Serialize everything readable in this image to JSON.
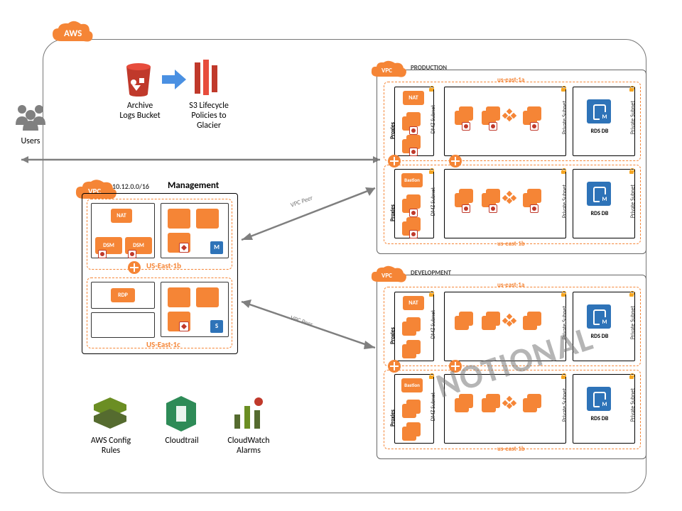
{
  "aws_badge": "AWS",
  "users_label": "Users",
  "archive": {
    "label": "Archive\nLogs Bucket"
  },
  "lifecycle": {
    "label": "S3 Lifecycle\nPolicies to\nGlacier"
  },
  "management": {
    "title": "Management",
    "cidr": "10.12.0.0/16",
    "vpc": "VPC",
    "nat": "NAT",
    "dsm1": "DSM",
    "dsm2": "DSM",
    "rdp": "RDP",
    "az1": "US-East-1b",
    "az2": "US-East-1c"
  },
  "peer1": "VPC Peer",
  "peer2": "VPC Peer",
  "prod": {
    "title": "PRODUCTION",
    "vpc": "VPC",
    "az1": "us-east-1a",
    "az2": "us-east-1b",
    "nat": "NAT",
    "bastion": "Bastion",
    "dmz": "DMZ Subnet",
    "priv": "Private Subnet",
    "rds": "RDS DB",
    "proxies": "Proxies"
  },
  "dev": {
    "title": "DEVELOPMENT",
    "vpc": "VPC",
    "az1": "us-east-1a",
    "az2": "us-east-1b",
    "nat": "NAT",
    "bastion": "Bastion",
    "dmz": "DMZ Subnet",
    "priv": "Private Subnet",
    "rds": "RDS DB",
    "proxies": "Proxies",
    "notional": "NOTIONAL"
  },
  "footer": {
    "config": "AWS Config\nRules",
    "cloudtrail": "Cloudtrail",
    "cwalarms": "CloudWatch\nAlarms"
  }
}
